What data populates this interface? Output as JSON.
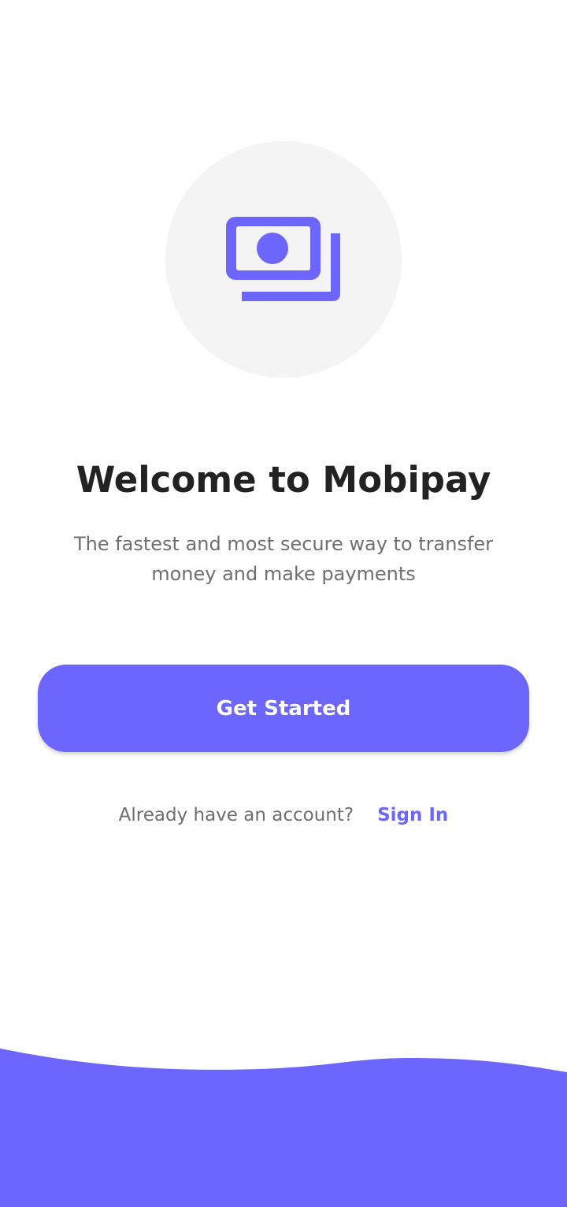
{
  "welcome": {
    "icon": "money-bills-icon",
    "title": "Welcome to Mobipay",
    "subtitle": "The fastest and most secure way to transfer money and make payments",
    "get_started_label": "Get Started",
    "account_prompt": "Already have an account?",
    "sign_in_label": "Sign In"
  },
  "colors": {
    "accent": "#6c66ff",
    "circle_background": "#f4f4f4",
    "title_text": "#222222",
    "body_text": "#6f6f6f"
  }
}
